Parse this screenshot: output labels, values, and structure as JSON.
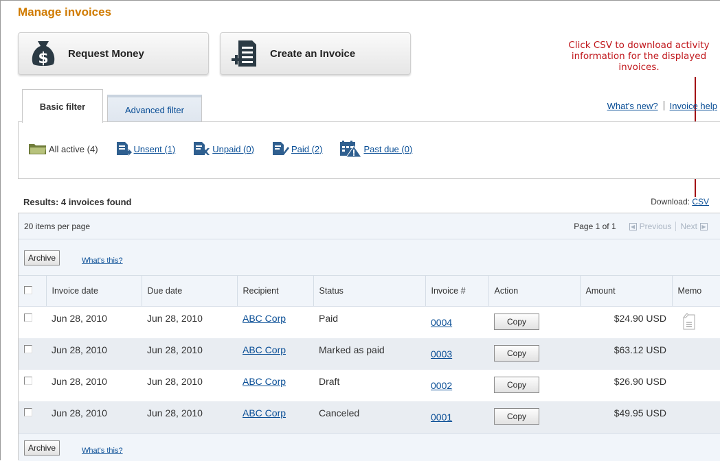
{
  "page_title": "Manage invoices",
  "buttons": {
    "request_money": "Request Money",
    "create_invoice": "Create an Invoice"
  },
  "annotation": "Click CSV to download activity information for the displayed invoices.",
  "tabs": [
    {
      "label": "Basic filter",
      "active": true
    },
    {
      "label": "Advanced filter",
      "active": false
    }
  ],
  "top_links": {
    "whats_new": "What's new?",
    "invoice_help": "Invoice help"
  },
  "filters": [
    {
      "label": "All active (4)",
      "icon": "folder-icon",
      "link": false
    },
    {
      "label": "Unsent (1)",
      "icon": "unsent-invoice-icon",
      "link": true
    },
    {
      "label": "Unpaid (0)",
      "icon": "unpaid-invoice-icon",
      "link": true
    },
    {
      "label": "Paid (2)",
      "icon": "paid-invoice-icon",
      "link": true
    },
    {
      "label": "Past due (0)",
      "icon": "past-due-icon",
      "link": true
    }
  ],
  "results": {
    "title": "Results: 4 invoices found",
    "download_label": "Download:",
    "download_link": "CSV"
  },
  "pager": {
    "per_page": "20 items per page",
    "page_info": "Page 1 of 1",
    "previous": "Previous",
    "next": "Next"
  },
  "archive": {
    "button": "Archive",
    "whats_this": "What's this?"
  },
  "table": {
    "columns": [
      "Invoice date",
      "Due date",
      "Recipient",
      "Status",
      "Invoice #",
      "Action",
      "Amount",
      "Memo"
    ],
    "rows": [
      {
        "invoice_date": "Jun 28, 2010",
        "due_date": "Jun 28, 2010",
        "recipient": "ABC Corp",
        "status": "Paid",
        "invoice_no": "0004",
        "action": "Copy",
        "amount": "$24.90 USD",
        "memo": true
      },
      {
        "invoice_date": "Jun 28, 2010",
        "due_date": "Jun 28, 2010",
        "recipient": "ABC Corp",
        "status": "Marked as paid",
        "invoice_no": "0003",
        "action": "Copy",
        "amount": "$63.12 USD",
        "memo": false
      },
      {
        "invoice_date": "Jun 28, 2010",
        "due_date": "Jun 28, 2010",
        "recipient": "ABC Corp",
        "status": "Draft",
        "invoice_no": "0002",
        "action": "Copy",
        "amount": "$26.90 USD",
        "memo": false
      },
      {
        "invoice_date": "Jun 28, 2010",
        "due_date": "Jun 28, 2010",
        "recipient": "ABC Corp",
        "status": "Canceled",
        "invoice_no": "0001",
        "action": "Copy",
        "amount": "$49.95 USD",
        "memo": false
      }
    ]
  },
  "colors": {
    "title_orange": "#d07b00",
    "link_blue": "#084d95",
    "annotation_red": "#c0171c",
    "panel_bg": "#f1f5fa",
    "alt_row": "#e9edf2"
  }
}
